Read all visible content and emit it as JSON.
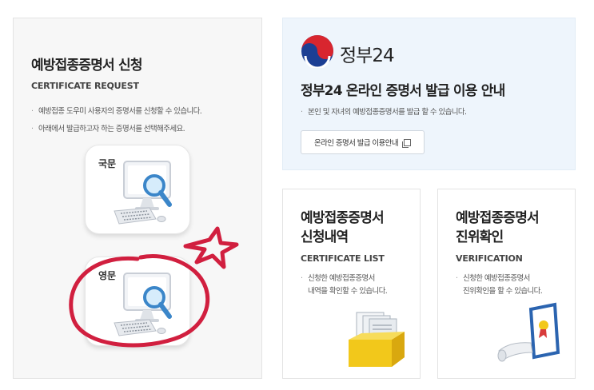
{
  "request": {
    "title": "예방접종증명서 신청",
    "subtitle": "CERTIFICATE REQUEST",
    "bullets": [
      "예방접종 도우미 사용자의 증명서를 신청할 수 있습니다.",
      "아래에서 발급하고자 하는 증명서를 선택해주세요."
    ],
    "options": [
      {
        "label": "국문",
        "icon": "computer-search-icon"
      },
      {
        "label": "영문",
        "icon": "computer-search-icon"
      }
    ]
  },
  "gov24": {
    "brand": "정부24",
    "logo_icon": "government-emblem-icon",
    "title": "정부24 온라인 증명서 발급 이용 안내",
    "bullet": "본인 및 자녀의 예방접종증명서를 발급 할 수 있습니다.",
    "button_label": "온라인 증명서 발급 이용안내",
    "button_icon": "new-window-icon"
  },
  "history": {
    "title_lines": [
      "예방접종증명서",
      "신청내역"
    ],
    "subtitle": "CERTIFICATE LIST",
    "bullet_lines": [
      "신청한 예방접종증명서",
      "내역을 확인할 수 있습니다."
    ],
    "icon": "document-box-icon"
  },
  "verify": {
    "title_lines": [
      "예방접종증명서",
      "진위확인"
    ],
    "subtitle": "VERIFICATION",
    "bullet_lines": [
      "신청한 예방접종증명서",
      "진위확인을 할 수 있습니다."
    ],
    "icon": "certificate-icon"
  },
  "annotation": {
    "color": "#d11f3f",
    "shapes": [
      "red-circle",
      "red-star"
    ]
  }
}
